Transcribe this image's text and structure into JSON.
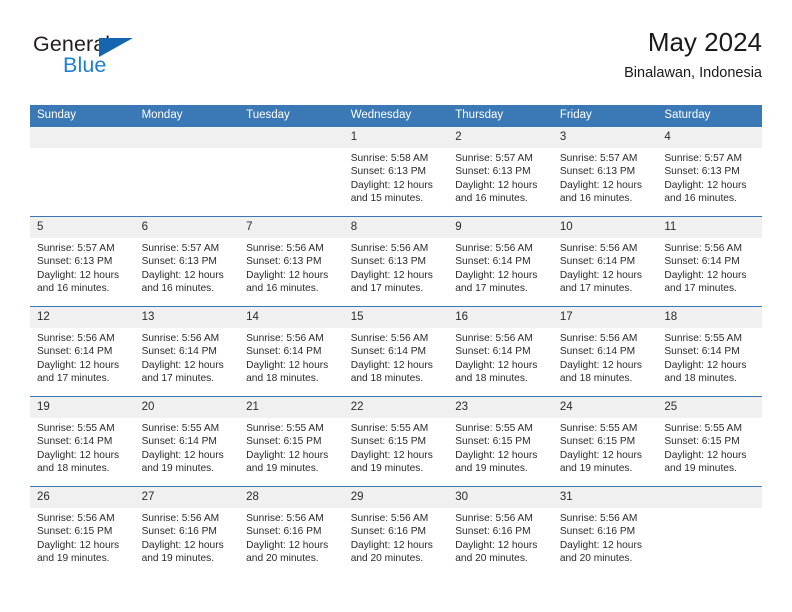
{
  "brand": {
    "name_part1": "General",
    "name_part2": "Blue",
    "triangle_color": "#1565b0",
    "blue_color": "#1f7fd0"
  },
  "header": {
    "title": "May 2024",
    "subtitle": "Binalawan, Indonesia",
    "header_bg": "#3b78b6",
    "header_text_color": "#ffffff",
    "daynum_bg": "#f0f0f0"
  },
  "weekdays": [
    "Sunday",
    "Monday",
    "Tuesday",
    "Wednesday",
    "Thursday",
    "Friday",
    "Saturday"
  ],
  "labels": {
    "sunrise": "Sunrise:",
    "sunset": "Sunset:",
    "daylight": "Daylight:"
  },
  "weeks": [
    [
      {
        "day": "",
        "empty": true
      },
      {
        "day": "",
        "empty": true
      },
      {
        "day": "",
        "empty": true
      },
      {
        "day": "1",
        "sunrise": "Sunrise: 5:58 AM",
        "sunset": "Sunset: 6:13 PM",
        "daylight_1": "Daylight: 12 hours",
        "daylight_2": "and 15 minutes."
      },
      {
        "day": "2",
        "sunrise": "Sunrise: 5:57 AM",
        "sunset": "Sunset: 6:13 PM",
        "daylight_1": "Daylight: 12 hours",
        "daylight_2": "and 16 minutes."
      },
      {
        "day": "3",
        "sunrise": "Sunrise: 5:57 AM",
        "sunset": "Sunset: 6:13 PM",
        "daylight_1": "Daylight: 12 hours",
        "daylight_2": "and 16 minutes."
      },
      {
        "day": "4",
        "sunrise": "Sunrise: 5:57 AM",
        "sunset": "Sunset: 6:13 PM",
        "daylight_1": "Daylight: 12 hours",
        "daylight_2": "and 16 minutes."
      }
    ],
    [
      {
        "day": "5",
        "sunrise": "Sunrise: 5:57 AM",
        "sunset": "Sunset: 6:13 PM",
        "daylight_1": "Daylight: 12 hours",
        "daylight_2": "and 16 minutes."
      },
      {
        "day": "6",
        "sunrise": "Sunrise: 5:57 AM",
        "sunset": "Sunset: 6:13 PM",
        "daylight_1": "Daylight: 12 hours",
        "daylight_2": "and 16 minutes."
      },
      {
        "day": "7",
        "sunrise": "Sunrise: 5:56 AM",
        "sunset": "Sunset: 6:13 PM",
        "daylight_1": "Daylight: 12 hours",
        "daylight_2": "and 16 minutes."
      },
      {
        "day": "8",
        "sunrise": "Sunrise: 5:56 AM",
        "sunset": "Sunset: 6:13 PM",
        "daylight_1": "Daylight: 12 hours",
        "daylight_2": "and 17 minutes."
      },
      {
        "day": "9",
        "sunrise": "Sunrise: 5:56 AM",
        "sunset": "Sunset: 6:14 PM",
        "daylight_1": "Daylight: 12 hours",
        "daylight_2": "and 17 minutes."
      },
      {
        "day": "10",
        "sunrise": "Sunrise: 5:56 AM",
        "sunset": "Sunset: 6:14 PM",
        "daylight_1": "Daylight: 12 hours",
        "daylight_2": "and 17 minutes."
      },
      {
        "day": "11",
        "sunrise": "Sunrise: 5:56 AM",
        "sunset": "Sunset: 6:14 PM",
        "daylight_1": "Daylight: 12 hours",
        "daylight_2": "and 17 minutes."
      }
    ],
    [
      {
        "day": "12",
        "sunrise": "Sunrise: 5:56 AM",
        "sunset": "Sunset: 6:14 PM",
        "daylight_1": "Daylight: 12 hours",
        "daylight_2": "and 17 minutes."
      },
      {
        "day": "13",
        "sunrise": "Sunrise: 5:56 AM",
        "sunset": "Sunset: 6:14 PM",
        "daylight_1": "Daylight: 12 hours",
        "daylight_2": "and 17 minutes."
      },
      {
        "day": "14",
        "sunrise": "Sunrise: 5:56 AM",
        "sunset": "Sunset: 6:14 PM",
        "daylight_1": "Daylight: 12 hours",
        "daylight_2": "and 18 minutes."
      },
      {
        "day": "15",
        "sunrise": "Sunrise: 5:56 AM",
        "sunset": "Sunset: 6:14 PM",
        "daylight_1": "Daylight: 12 hours",
        "daylight_2": "and 18 minutes."
      },
      {
        "day": "16",
        "sunrise": "Sunrise: 5:56 AM",
        "sunset": "Sunset: 6:14 PM",
        "daylight_1": "Daylight: 12 hours",
        "daylight_2": "and 18 minutes."
      },
      {
        "day": "17",
        "sunrise": "Sunrise: 5:56 AM",
        "sunset": "Sunset: 6:14 PM",
        "daylight_1": "Daylight: 12 hours",
        "daylight_2": "and 18 minutes."
      },
      {
        "day": "18",
        "sunrise": "Sunrise: 5:55 AM",
        "sunset": "Sunset: 6:14 PM",
        "daylight_1": "Daylight: 12 hours",
        "daylight_2": "and 18 minutes."
      }
    ],
    [
      {
        "day": "19",
        "sunrise": "Sunrise: 5:55 AM",
        "sunset": "Sunset: 6:14 PM",
        "daylight_1": "Daylight: 12 hours",
        "daylight_2": "and 18 minutes."
      },
      {
        "day": "20",
        "sunrise": "Sunrise: 5:55 AM",
        "sunset": "Sunset: 6:14 PM",
        "daylight_1": "Daylight: 12 hours",
        "daylight_2": "and 19 minutes."
      },
      {
        "day": "21",
        "sunrise": "Sunrise: 5:55 AM",
        "sunset": "Sunset: 6:15 PM",
        "daylight_1": "Daylight: 12 hours",
        "daylight_2": "and 19 minutes."
      },
      {
        "day": "22",
        "sunrise": "Sunrise: 5:55 AM",
        "sunset": "Sunset: 6:15 PM",
        "daylight_1": "Daylight: 12 hours",
        "daylight_2": "and 19 minutes."
      },
      {
        "day": "23",
        "sunrise": "Sunrise: 5:55 AM",
        "sunset": "Sunset: 6:15 PM",
        "daylight_1": "Daylight: 12 hours",
        "daylight_2": "and 19 minutes."
      },
      {
        "day": "24",
        "sunrise": "Sunrise: 5:55 AM",
        "sunset": "Sunset: 6:15 PM",
        "daylight_1": "Daylight: 12 hours",
        "daylight_2": "and 19 minutes."
      },
      {
        "day": "25",
        "sunrise": "Sunrise: 5:55 AM",
        "sunset": "Sunset: 6:15 PM",
        "daylight_1": "Daylight: 12 hours",
        "daylight_2": "and 19 minutes."
      }
    ],
    [
      {
        "day": "26",
        "sunrise": "Sunrise: 5:56 AM",
        "sunset": "Sunset: 6:15 PM",
        "daylight_1": "Daylight: 12 hours",
        "daylight_2": "and 19 minutes."
      },
      {
        "day": "27",
        "sunrise": "Sunrise: 5:56 AM",
        "sunset": "Sunset: 6:16 PM",
        "daylight_1": "Daylight: 12 hours",
        "daylight_2": "and 19 minutes."
      },
      {
        "day": "28",
        "sunrise": "Sunrise: 5:56 AM",
        "sunset": "Sunset: 6:16 PM",
        "daylight_1": "Daylight: 12 hours",
        "daylight_2": "and 20 minutes."
      },
      {
        "day": "29",
        "sunrise": "Sunrise: 5:56 AM",
        "sunset": "Sunset: 6:16 PM",
        "daylight_1": "Daylight: 12 hours",
        "daylight_2": "and 20 minutes."
      },
      {
        "day": "30",
        "sunrise": "Sunrise: 5:56 AM",
        "sunset": "Sunset: 6:16 PM",
        "daylight_1": "Daylight: 12 hours",
        "daylight_2": "and 20 minutes."
      },
      {
        "day": "31",
        "sunrise": "Sunrise: 5:56 AM",
        "sunset": "Sunset: 6:16 PM",
        "daylight_1": "Daylight: 12 hours",
        "daylight_2": "and 20 minutes."
      },
      {
        "day": "",
        "empty": true
      }
    ]
  ]
}
